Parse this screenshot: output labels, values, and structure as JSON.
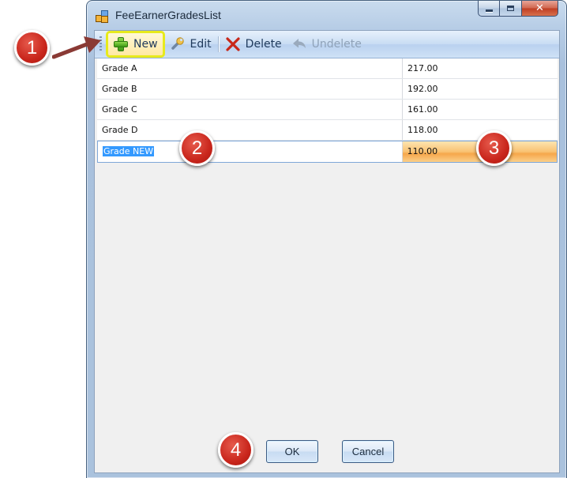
{
  "window": {
    "title": "FeeEarnerGradesList",
    "controls": {
      "minimize": "minimize",
      "maximize": "maximize",
      "close": "✕"
    }
  },
  "toolbar": {
    "new_label": "New",
    "edit_label": "Edit",
    "delete_label": "Delete",
    "undelete_label": "Undelete"
  },
  "grid": {
    "rows": [
      {
        "name": "Grade A",
        "rate": "217.00"
      },
      {
        "name": "Grade B",
        "rate": "192.00"
      },
      {
        "name": "Grade C",
        "rate": "161.00"
      },
      {
        "name": "Grade D",
        "rate": "118.00"
      },
      {
        "name": "Grade NEW",
        "rate": "110.00"
      }
    ]
  },
  "buttons": {
    "ok": "OK",
    "cancel": "Cancel"
  },
  "callouts": [
    "1",
    "2",
    "3",
    "4"
  ],
  "colors": {
    "callout": "#c9261c",
    "highlight": "#e7ea1c",
    "selection": "#3399ff"
  }
}
